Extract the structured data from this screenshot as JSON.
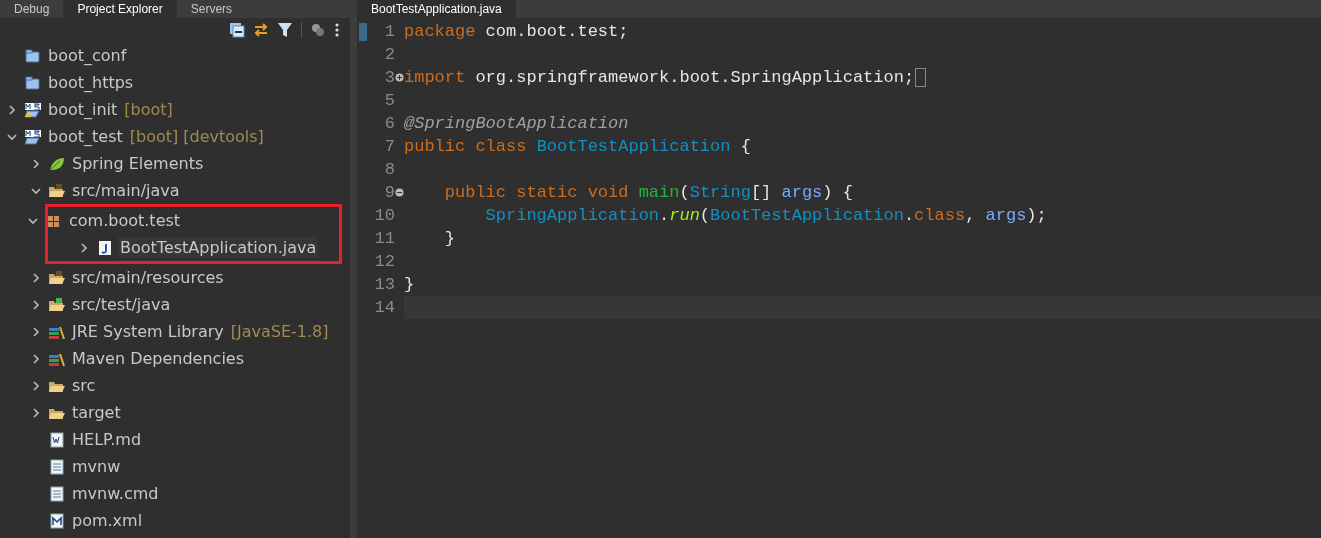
{
  "left_tabs": [
    {
      "label": "Debug",
      "selected": false
    },
    {
      "label": "Project Explorer",
      "selected": true
    },
    {
      "label": "Servers",
      "selected": false
    }
  ],
  "toolbar": [
    {
      "kind": "collapse"
    },
    {
      "kind": "link"
    },
    {
      "kind": "filter"
    },
    {
      "kind": "separator"
    },
    {
      "kind": "view"
    },
    {
      "kind": "more"
    }
  ],
  "tree": [
    {
      "label": "boot_conf",
      "kind": "project"
    },
    {
      "label": "boot_https",
      "kind": "project"
    },
    {
      "label": "boot_init",
      "kind": "spring-project-warning",
      "decorations": [
        "[boot]"
      ],
      "expanded": false
    },
    {
      "label": "boot_test",
      "kind": "spring-project",
      "decorations": [
        "[boot]",
        "[devtools]"
      ],
      "expanded": true,
      "children": [
        {
          "label": "Spring Elements",
          "kind": "spring",
          "expanded": false
        },
        {
          "label": "src/main/java",
          "kind": "source-folder",
          "expanded": true,
          "children": [
            {
              "label": "com.boot.test",
              "kind": "package",
              "expanded": true,
              "highlighted": true,
              "children": [
                {
                  "label": "BootTestApplication.java",
                  "kind": "java",
                  "expanded": false,
                  "selected": true
                }
              ]
            }
          ]
        },
        {
          "label": "src/main/resources",
          "kind": "source-folder",
          "expanded": false
        },
        {
          "label": "src/test/java",
          "kind": "test-folder",
          "expanded": false
        },
        {
          "label": "JRE System Library",
          "kind": "library",
          "decorations": [
            "[JavaSE-1.8]"
          ],
          "expanded": false
        },
        {
          "label": "Maven Dependencies",
          "kind": "library",
          "expanded": false
        },
        {
          "label": "src",
          "kind": "folder",
          "expanded": false
        },
        {
          "label": "target",
          "kind": "folder",
          "expanded": false
        },
        {
          "label": "HELP.md",
          "kind": "word"
        },
        {
          "label": "mvnw",
          "kind": "text"
        },
        {
          "label": "mvnw.cmd",
          "kind": "text"
        },
        {
          "label": "pom.xml",
          "kind": "maven"
        }
      ]
    }
  ],
  "editor_tabs": [
    {
      "label": "BootTestApplication.java",
      "selected": true
    }
  ],
  "code_lines": [
    {
      "number": "1",
      "marker": true,
      "tokens": [
        {
          "kind": "keyword",
          "text": "package"
        },
        {
          "kind": "plain",
          "text": " com.boot.test;"
        }
      ]
    },
    {
      "number": "2"
    },
    {
      "number": "3",
      "folded": true,
      "tokens": [
        {
          "kind": "keyword",
          "text": "import"
        },
        {
          "kind": "plain",
          "text": " org.springframework.boot.SpringApplication;"
        }
      ]
    },
    {
      "number": "5"
    },
    {
      "number": "6",
      "tokens": [
        {
          "kind": "annotation",
          "text": "@SpringBootApplication"
        }
      ]
    },
    {
      "number": "7",
      "tokens": [
        {
          "kind": "keyword",
          "text": "public"
        },
        {
          "kind": "keyword",
          "text": " class"
        },
        {
          "kind": "type",
          "text": " BootTestApplication"
        },
        {
          "kind": "plain",
          "text": " {"
        }
      ]
    },
    {
      "number": "8"
    },
    {
      "number": "9",
      "folded": false,
      "tokens": [
        {
          "kind": "keyword",
          "text": "    public"
        },
        {
          "kind": "keyword",
          "text": " static"
        },
        {
          "kind": "keyword",
          "text": " void"
        },
        {
          "kind": "method",
          "text": " main"
        },
        {
          "kind": "plain",
          "text": "("
        },
        {
          "kind": "type",
          "text": "String"
        },
        {
          "kind": "plain",
          "text": "[]"
        },
        {
          "kind": "param",
          "text": " args"
        },
        {
          "kind": "plain",
          "text": ") {"
        }
      ]
    },
    {
      "number": "10",
      "tokens": [
        {
          "kind": "type",
          "text": "        SpringApplication"
        },
        {
          "kind": "plain",
          "text": "."
        },
        {
          "kind": "static-call",
          "text": "run"
        },
        {
          "kind": "plain",
          "text": "("
        },
        {
          "kind": "type",
          "text": "BootTestApplication"
        },
        {
          "kind": "plain",
          "text": "."
        },
        {
          "kind": "keyword",
          "text": "class"
        },
        {
          "kind": "plain",
          "text": ","
        },
        {
          "kind": "param",
          "text": " args"
        },
        {
          "kind": "plain",
          "text": ");"
        }
      ]
    },
    {
      "number": "11",
      "tokens": [
        {
          "kind": "plain",
          "text": "    }"
        }
      ]
    },
    {
      "number": "12"
    },
    {
      "number": "13",
      "tokens": [
        {
          "kind": "plain",
          "text": "}"
        }
      ]
    },
    {
      "number": "14",
      "current": true
    }
  ]
}
